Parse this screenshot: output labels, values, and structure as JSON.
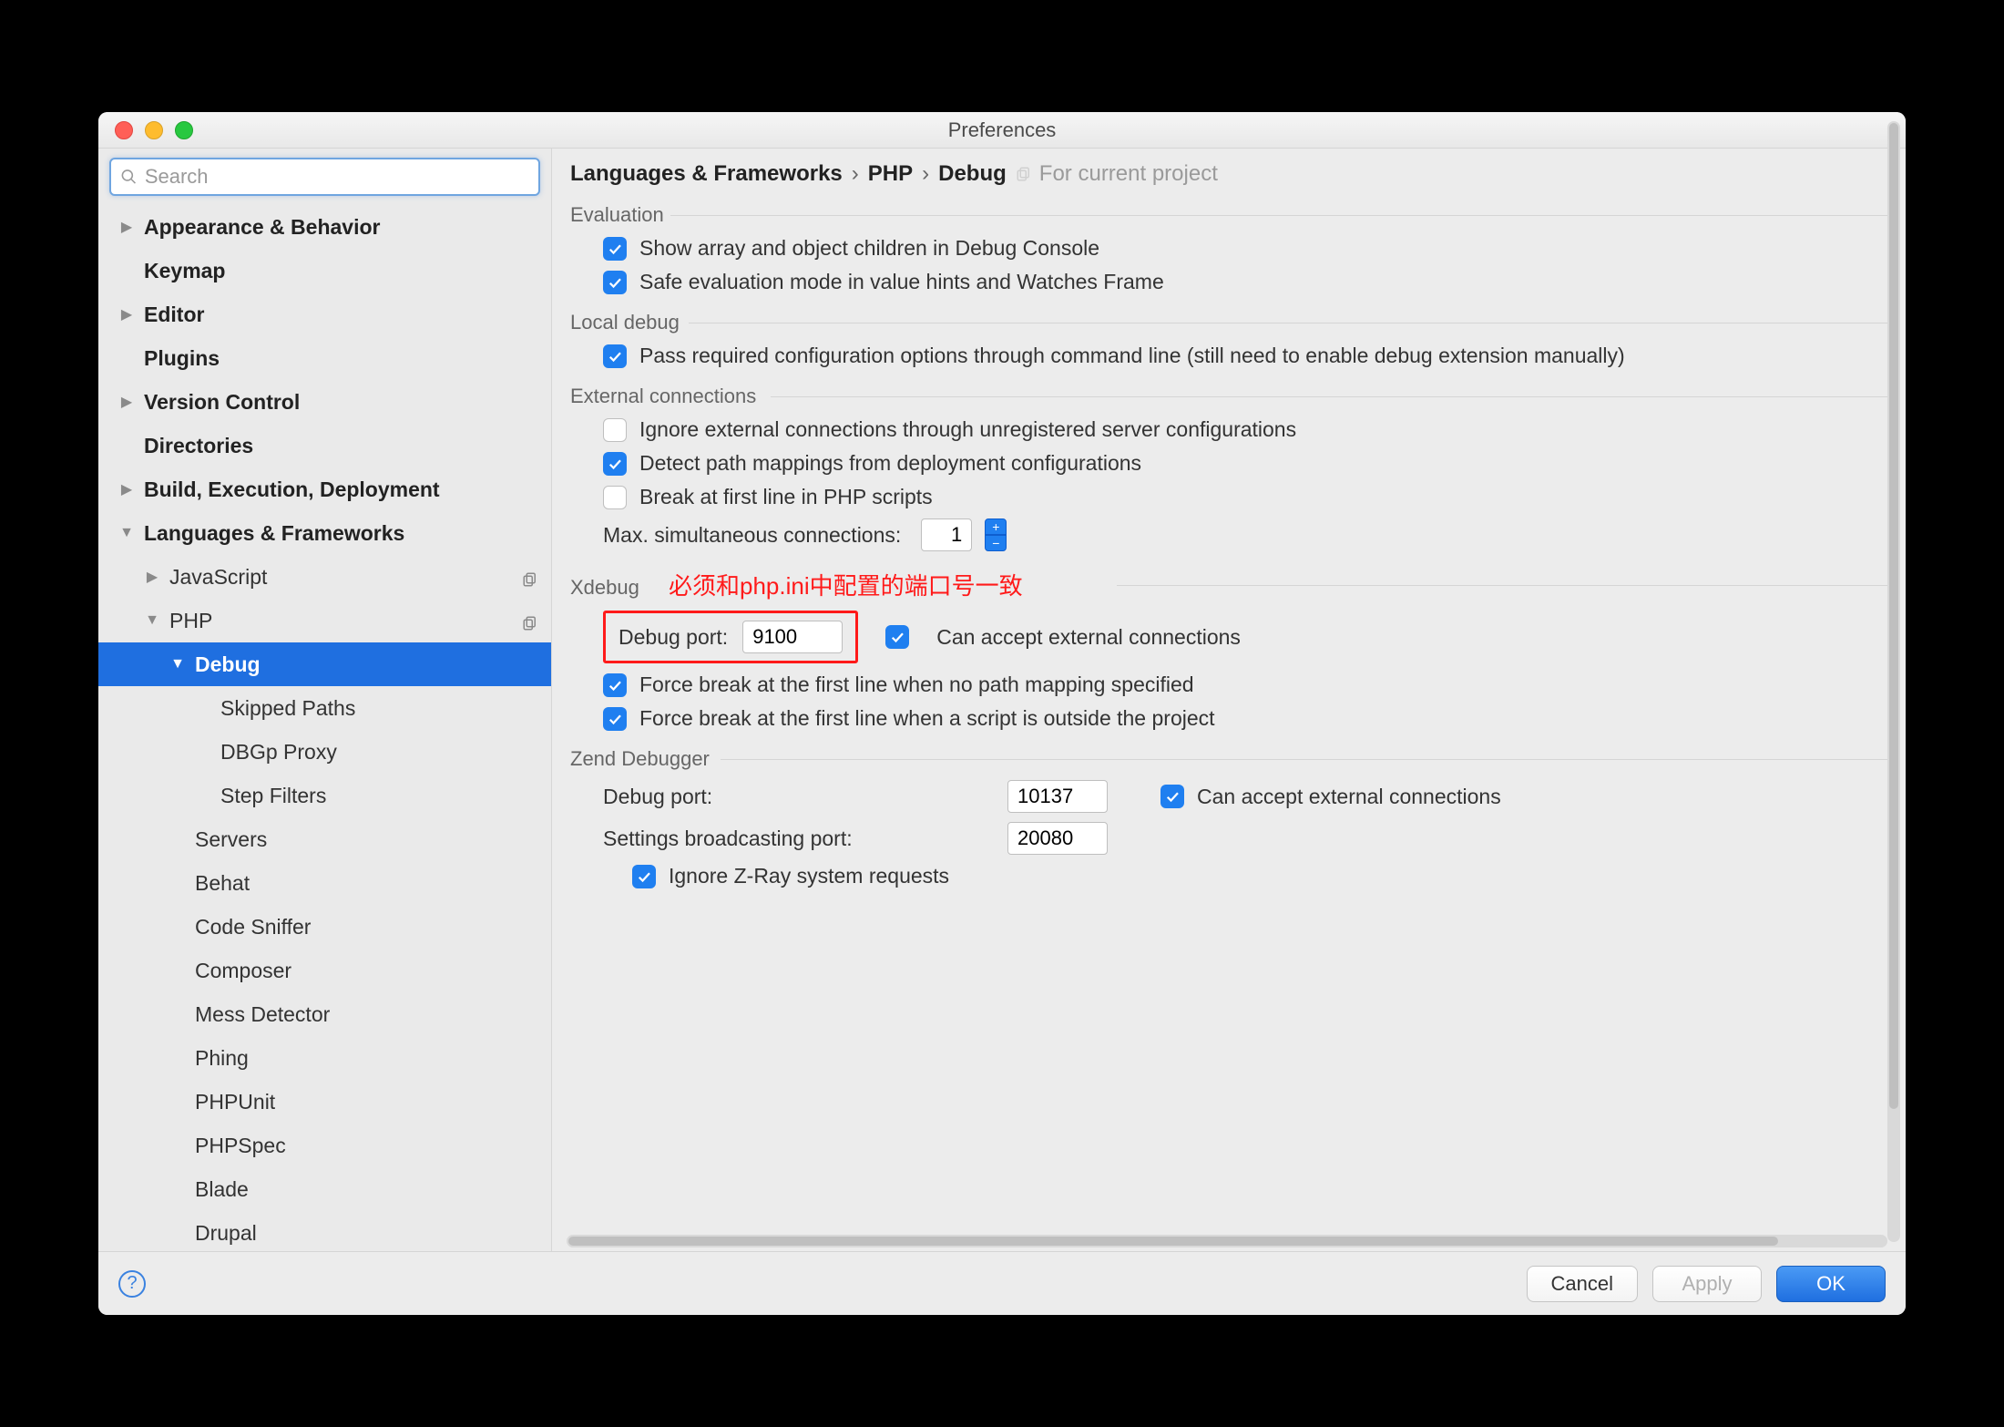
{
  "window": {
    "title": "Preferences"
  },
  "search": {
    "placeholder": "Search"
  },
  "sidebar": {
    "items": [
      {
        "label": "Appearance & Behavior",
        "indent": 0,
        "arrow": "right",
        "bold": true
      },
      {
        "label": "Keymap",
        "indent": 0,
        "arrow": "none",
        "bold": true
      },
      {
        "label": "Editor",
        "indent": 0,
        "arrow": "right",
        "bold": true
      },
      {
        "label": "Plugins",
        "indent": 0,
        "arrow": "none",
        "bold": true
      },
      {
        "label": "Version Control",
        "indent": 0,
        "arrow": "right",
        "bold": true
      },
      {
        "label": "Directories",
        "indent": 0,
        "arrow": "none",
        "bold": true
      },
      {
        "label": "Build, Execution, Deployment",
        "indent": 0,
        "arrow": "right",
        "bold": true
      },
      {
        "label": "Languages & Frameworks",
        "indent": 0,
        "arrow": "down",
        "bold": true
      },
      {
        "label": "JavaScript",
        "indent": 1,
        "arrow": "right",
        "badge": true
      },
      {
        "label": "PHP",
        "indent": 1,
        "arrow": "down",
        "badge": true
      },
      {
        "label": "Debug",
        "indent": 2,
        "arrow": "down",
        "selected": true
      },
      {
        "label": "Skipped Paths",
        "indent": 3,
        "arrow": "none"
      },
      {
        "label": "DBGp Proxy",
        "indent": 3,
        "arrow": "none"
      },
      {
        "label": "Step Filters",
        "indent": 3,
        "arrow": "none"
      },
      {
        "label": "Servers",
        "indent": 2,
        "arrow": "none"
      },
      {
        "label": "Behat",
        "indent": 2,
        "arrow": "none"
      },
      {
        "label": "Code Sniffer",
        "indent": 2,
        "arrow": "none"
      },
      {
        "label": "Composer",
        "indent": 2,
        "arrow": "none"
      },
      {
        "label": "Mess Detector",
        "indent": 2,
        "arrow": "none"
      },
      {
        "label": "Phing",
        "indent": 2,
        "arrow": "none"
      },
      {
        "label": "PHPUnit",
        "indent": 2,
        "arrow": "none"
      },
      {
        "label": "PHPSpec",
        "indent": 2,
        "arrow": "none"
      },
      {
        "label": "Blade",
        "indent": 2,
        "arrow": "none"
      },
      {
        "label": "Drupal",
        "indent": 2,
        "arrow": "none"
      }
    ]
  },
  "breadcrumb": {
    "a": "Languages & Frameworks",
    "b": "PHP",
    "c": "Debug",
    "scope": "For current project"
  },
  "sections": {
    "evaluation": {
      "title": "Evaluation",
      "c1": "Show array and object children in Debug Console",
      "c2": "Safe evaluation mode in value hints and Watches Frame"
    },
    "local_debug": {
      "title": "Local debug",
      "c1": "Pass required configuration options through command line (still need to enable debug extension manually)"
    },
    "external": {
      "title": "External connections",
      "c1": "Ignore external connections through unregistered server configurations",
      "c2": "Detect path mappings from deployment configurations",
      "c3": "Break at first line in PHP scripts",
      "max_label": "Max. simultaneous connections:",
      "max_value": "1"
    },
    "xdebug": {
      "title": "Xdebug",
      "annotation": "必须和php.ini中配置的端口号一致",
      "port_label": "Debug port:",
      "port_value": "9100",
      "accept": "Can accept external connections",
      "fb1": "Force break at the first line when no path mapping specified",
      "fb2": "Force break at the first line when a script is outside the project"
    },
    "zend": {
      "title": "Zend Debugger",
      "port_label": "Debug port:",
      "port_value": "10137",
      "accept": "Can accept external connections",
      "bcast_label": "Settings broadcasting port:",
      "bcast_value": "20080",
      "ignore": "Ignore Z-Ray system requests"
    }
  },
  "footer": {
    "cancel": "Cancel",
    "apply": "Apply",
    "ok": "OK"
  }
}
